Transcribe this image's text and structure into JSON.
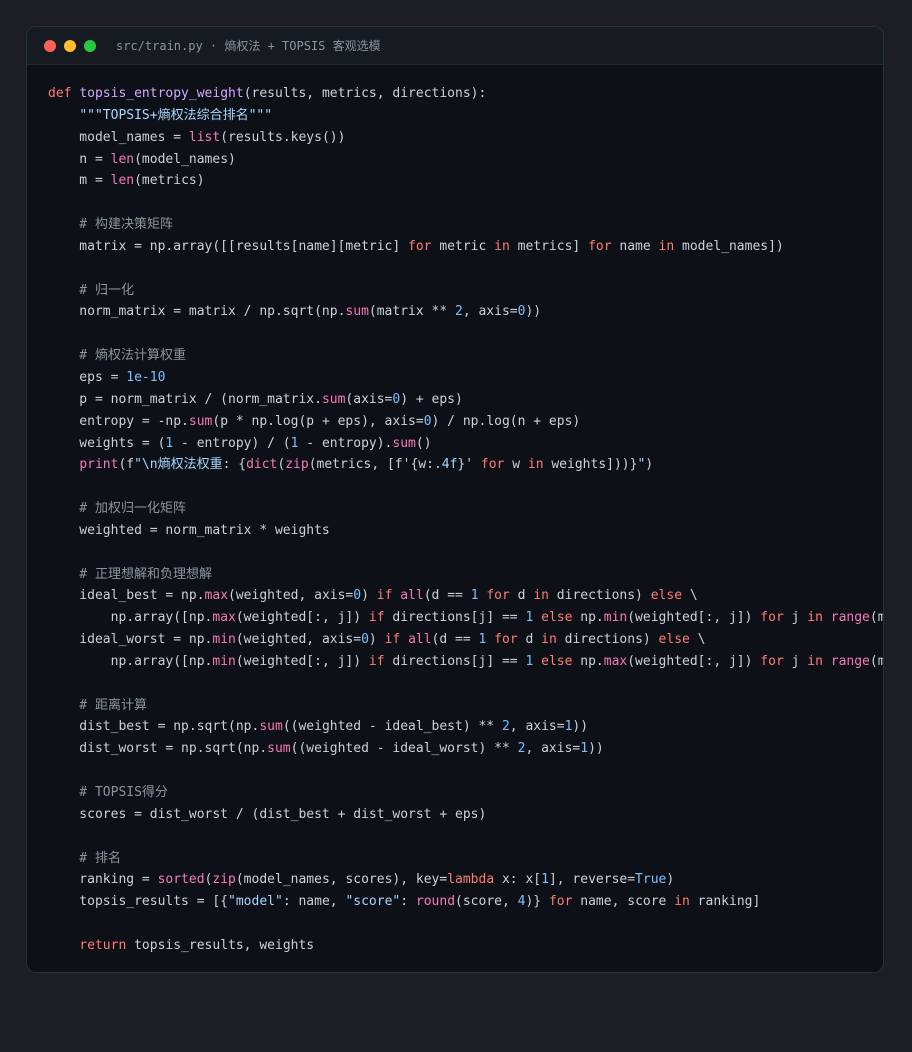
{
  "window": {
    "title": "src/train.py · 熵权法 + TOPSIS 客观选模"
  },
  "code": [
    [
      [
        "kw",
        "def "
      ],
      [
        "fn",
        "topsis_entropy_weight"
      ],
      [
        "txt",
        "(results, metrics, directions):"
      ]
    ],
    [
      [
        "txt",
        "    "
      ],
      [
        "str",
        "\"\"\"TOPSIS+熵权法综合排名\"\"\""
      ]
    ],
    [
      [
        "txt",
        "    model_names = "
      ],
      [
        "bi",
        "list"
      ],
      [
        "txt",
        "(results.keys())"
      ]
    ],
    [
      [
        "txt",
        "    n = "
      ],
      [
        "bi",
        "len"
      ],
      [
        "txt",
        "(model_names)"
      ]
    ],
    [
      [
        "txt",
        "    m = "
      ],
      [
        "bi",
        "len"
      ],
      [
        "txt",
        "(metrics)"
      ]
    ],
    [],
    [
      [
        "com",
        "    # 构建决策矩阵"
      ]
    ],
    [
      [
        "txt",
        "    matrix = np.array([[results[name][metric] "
      ],
      [
        "kw",
        "for"
      ],
      [
        "txt",
        " metric "
      ],
      [
        "kw",
        "in"
      ],
      [
        "txt",
        " metrics] "
      ],
      [
        "kw",
        "for"
      ],
      [
        "txt",
        " name "
      ],
      [
        "kw",
        "in"
      ],
      [
        "txt",
        " model_names])"
      ]
    ],
    [],
    [
      [
        "com",
        "    # 归一化"
      ]
    ],
    [
      [
        "txt",
        "    norm_matrix = matrix / np.sqrt(np."
      ],
      [
        "bi",
        "sum"
      ],
      [
        "txt",
        "(matrix ** "
      ],
      [
        "num",
        "2"
      ],
      [
        "txt",
        ", axis="
      ],
      [
        "num",
        "0"
      ],
      [
        "txt",
        "))"
      ]
    ],
    [],
    [
      [
        "com",
        "    # 熵权法计算权重"
      ]
    ],
    [
      [
        "txt",
        "    eps = "
      ],
      [
        "num",
        "1e-10"
      ]
    ],
    [
      [
        "txt",
        "    p = norm_matrix / (norm_matrix."
      ],
      [
        "bi",
        "sum"
      ],
      [
        "txt",
        "(axis="
      ],
      [
        "num",
        "0"
      ],
      [
        "txt",
        ") + eps)"
      ]
    ],
    [
      [
        "txt",
        "    entropy = -np."
      ],
      [
        "bi",
        "sum"
      ],
      [
        "txt",
        "(p * np.log(p + eps), axis="
      ],
      [
        "num",
        "0"
      ],
      [
        "txt",
        ") / np.log(n + eps)"
      ]
    ],
    [
      [
        "txt",
        "    weights = ("
      ],
      [
        "num",
        "1"
      ],
      [
        "txt",
        " - entropy) / ("
      ],
      [
        "num",
        "1"
      ],
      [
        "txt",
        " - entropy)."
      ],
      [
        "bi",
        "sum"
      ],
      [
        "txt",
        "()"
      ]
    ],
    [
      [
        "txt",
        "    "
      ],
      [
        "bi",
        "print"
      ],
      [
        "txt",
        "(f"
      ],
      [
        "str",
        "\"\\n熵权法权重: "
      ],
      [
        "txt",
        "{"
      ],
      [
        "bi",
        "dict"
      ],
      [
        "txt",
        "("
      ],
      [
        "bi",
        "zip"
      ],
      [
        "txt",
        "(metrics, [f"
      ],
      [
        "str",
        "'"
      ],
      [
        "txt",
        "{w:"
      ],
      [
        "str",
        ".4f"
      ],
      [
        "txt",
        "}"
      ],
      [
        "str",
        "'"
      ],
      [
        "txt",
        " "
      ],
      [
        "kw",
        "for"
      ],
      [
        "txt",
        " w "
      ],
      [
        "kw",
        "in"
      ],
      [
        "txt",
        " weights]))}"
      ],
      [
        "str",
        "\""
      ],
      [
        "txt",
        ")"
      ]
    ],
    [],
    [
      [
        "com",
        "    # 加权归一化矩阵"
      ]
    ],
    [
      [
        "txt",
        "    weighted = norm_matrix * weights"
      ]
    ],
    [],
    [
      [
        "com",
        "    # 正理想解和负理想解"
      ]
    ],
    [
      [
        "txt",
        "    ideal_best = np."
      ],
      [
        "bi",
        "max"
      ],
      [
        "txt",
        "(weighted, axis="
      ],
      [
        "num",
        "0"
      ],
      [
        "txt",
        ") "
      ],
      [
        "kw",
        "if"
      ],
      [
        "txt",
        " "
      ],
      [
        "bi",
        "all"
      ],
      [
        "txt",
        "(d == "
      ],
      [
        "num",
        "1"
      ],
      [
        "txt",
        " "
      ],
      [
        "kw",
        "for"
      ],
      [
        "txt",
        " d "
      ],
      [
        "kw",
        "in"
      ],
      [
        "txt",
        " directions) "
      ],
      [
        "kw",
        "else"
      ],
      [
        "txt",
        " \\"
      ]
    ],
    [
      [
        "txt",
        "        np.array([np."
      ],
      [
        "bi",
        "max"
      ],
      [
        "txt",
        "(weighted[:, j]) "
      ],
      [
        "kw",
        "if"
      ],
      [
        "txt",
        " directions[j] == "
      ],
      [
        "num",
        "1"
      ],
      [
        "txt",
        " "
      ],
      [
        "kw",
        "else"
      ],
      [
        "txt",
        " np."
      ],
      [
        "bi",
        "min"
      ],
      [
        "txt",
        "(weighted[:, j]) "
      ],
      [
        "kw",
        "for"
      ],
      [
        "txt",
        " j "
      ],
      [
        "kw",
        "in"
      ],
      [
        "txt",
        " "
      ],
      [
        "bi",
        "range"
      ],
      [
        "txt",
        "(m)])"
      ]
    ],
    [
      [
        "txt",
        "    ideal_worst = np."
      ],
      [
        "bi",
        "min"
      ],
      [
        "txt",
        "(weighted, axis="
      ],
      [
        "num",
        "0"
      ],
      [
        "txt",
        ") "
      ],
      [
        "kw",
        "if"
      ],
      [
        "txt",
        " "
      ],
      [
        "bi",
        "all"
      ],
      [
        "txt",
        "(d == "
      ],
      [
        "num",
        "1"
      ],
      [
        "txt",
        " "
      ],
      [
        "kw",
        "for"
      ],
      [
        "txt",
        " d "
      ],
      [
        "kw",
        "in"
      ],
      [
        "txt",
        " directions) "
      ],
      [
        "kw",
        "else"
      ],
      [
        "txt",
        " \\"
      ]
    ],
    [
      [
        "txt",
        "        np.array([np."
      ],
      [
        "bi",
        "min"
      ],
      [
        "txt",
        "(weighted[:, j]) "
      ],
      [
        "kw",
        "if"
      ],
      [
        "txt",
        " directions[j] == "
      ],
      [
        "num",
        "1"
      ],
      [
        "txt",
        " "
      ],
      [
        "kw",
        "else"
      ],
      [
        "txt",
        " np."
      ],
      [
        "bi",
        "max"
      ],
      [
        "txt",
        "(weighted[:, j]) "
      ],
      [
        "kw",
        "for"
      ],
      [
        "txt",
        " j "
      ],
      [
        "kw",
        "in"
      ],
      [
        "txt",
        " "
      ],
      [
        "bi",
        "range"
      ],
      [
        "txt",
        "(m)])"
      ]
    ],
    [],
    [
      [
        "com",
        "    # 距离计算"
      ]
    ],
    [
      [
        "txt",
        "    dist_best = np.sqrt(np."
      ],
      [
        "bi",
        "sum"
      ],
      [
        "txt",
        "((weighted - ideal_best) ** "
      ],
      [
        "num",
        "2"
      ],
      [
        "txt",
        ", axis="
      ],
      [
        "num",
        "1"
      ],
      [
        "txt",
        "))"
      ]
    ],
    [
      [
        "txt",
        "    dist_worst = np.sqrt(np."
      ],
      [
        "bi",
        "sum"
      ],
      [
        "txt",
        "((weighted - ideal_worst) ** "
      ],
      [
        "num",
        "2"
      ],
      [
        "txt",
        ", axis="
      ],
      [
        "num",
        "1"
      ],
      [
        "txt",
        "))"
      ]
    ],
    [],
    [
      [
        "com",
        "    # TOPSIS得分"
      ]
    ],
    [
      [
        "txt",
        "    scores = dist_worst / (dist_best + dist_worst + eps)"
      ]
    ],
    [],
    [
      [
        "com",
        "    # 排名"
      ]
    ],
    [
      [
        "txt",
        "    ranking = "
      ],
      [
        "bi",
        "sorted"
      ],
      [
        "txt",
        "("
      ],
      [
        "bi",
        "zip"
      ],
      [
        "txt",
        "(model_names, scores), key="
      ],
      [
        "kw",
        "lambda"
      ],
      [
        "txt",
        " x: x["
      ],
      [
        "num",
        "1"
      ],
      [
        "txt",
        "], reverse="
      ],
      [
        "num",
        "True"
      ],
      [
        "txt",
        ")"
      ]
    ],
    [
      [
        "txt",
        "    topsis_results = [{"
      ],
      [
        "str",
        "\"model\""
      ],
      [
        "txt",
        ": name, "
      ],
      [
        "str",
        "\"score\""
      ],
      [
        "txt",
        ": "
      ],
      [
        "bi",
        "round"
      ],
      [
        "txt",
        "(score, "
      ],
      [
        "num",
        "4"
      ],
      [
        "txt",
        ")} "
      ],
      [
        "kw",
        "for"
      ],
      [
        "txt",
        " name, score "
      ],
      [
        "kw",
        "in"
      ],
      [
        "txt",
        " ranking]"
      ]
    ],
    [],
    [
      [
        "txt",
        "    "
      ],
      [
        "kw",
        "return"
      ],
      [
        "txt",
        " topsis_results, weights"
      ]
    ]
  ]
}
